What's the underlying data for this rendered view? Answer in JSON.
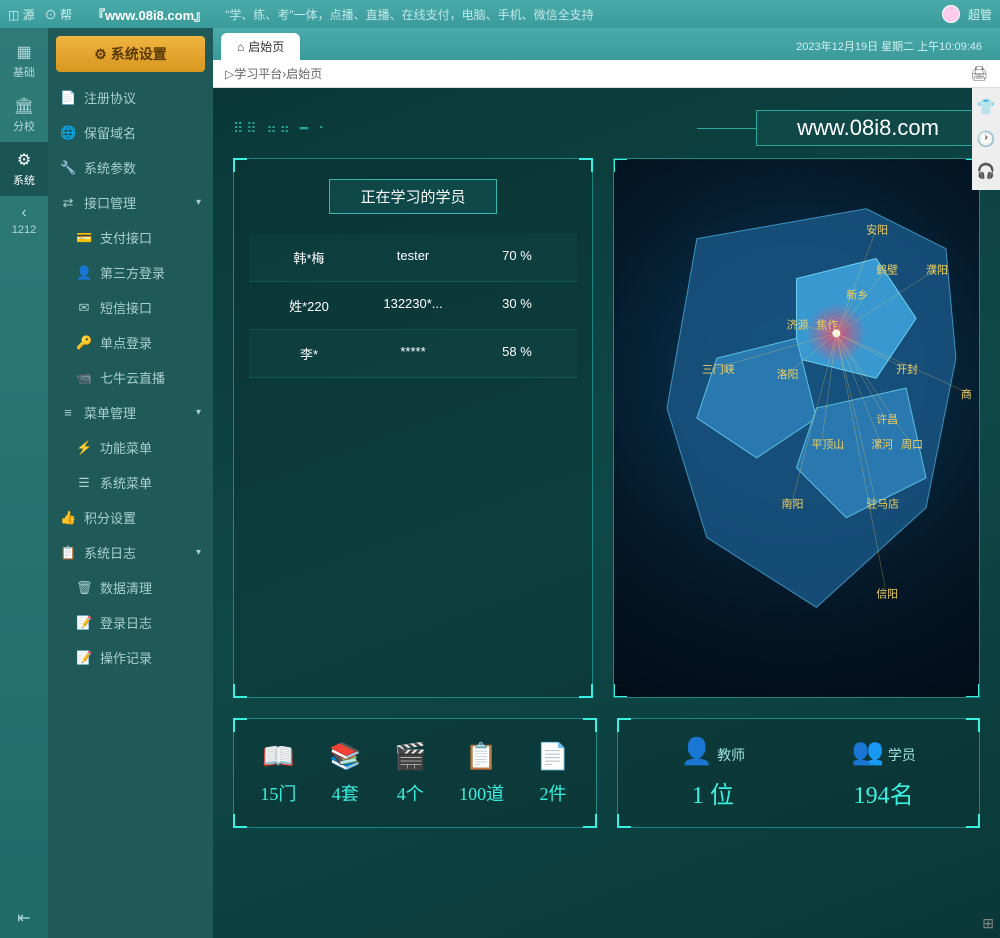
{
  "topbar": {
    "source": "源",
    "help": "帮",
    "site": "『www.08i8.com』",
    "tagline": "\"学、练、考\"一体，点播、直播、在线支付，电脑、手机、微信全支持",
    "user": "超管"
  },
  "leftbar": {
    "items": [
      {
        "label": "基础"
      },
      {
        "label": "分校"
      },
      {
        "label": "系统"
      }
    ],
    "history": "1212"
  },
  "sidebar": {
    "header": "⚙ 系统设置",
    "items": [
      {
        "icon": "📄",
        "label": "注册协议"
      },
      {
        "icon": "🌐",
        "label": "保留域名"
      },
      {
        "icon": "🔧",
        "label": "系统参数"
      },
      {
        "icon": "⇄",
        "label": "接口管理",
        "expand": true
      },
      {
        "icon": "💳",
        "label": "支付接口",
        "sub": true
      },
      {
        "icon": "👤",
        "label": "第三方登录",
        "sub": true
      },
      {
        "icon": "✉",
        "label": "短信接口",
        "sub": true
      },
      {
        "icon": "🔑",
        "label": "单点登录",
        "sub": true
      },
      {
        "icon": "📹",
        "label": "七牛云直播",
        "sub": true
      },
      {
        "icon": "≡",
        "label": "菜单管理",
        "expand": true
      },
      {
        "icon": "⚡",
        "label": "功能菜单",
        "sub": true
      },
      {
        "icon": "☰",
        "label": "系统菜单",
        "sub": true
      },
      {
        "icon": "👍",
        "label": "积分设置"
      },
      {
        "icon": "📋",
        "label": "系统日志",
        "expand": true
      },
      {
        "icon": "🗑",
        "label": "数据清理",
        "sub": true
      },
      {
        "icon": "📝",
        "label": "登录日志",
        "sub": true
      },
      {
        "icon": "📝",
        "label": "操作记录",
        "sub": true
      }
    ]
  },
  "tabs": {
    "active": "启始页",
    "datetime": "2023年12月19日 星期二 上午10:09:46"
  },
  "breadcrumb": {
    "root": "学习平台",
    "page": "启始页"
  },
  "dashboard": {
    "brand": "www.08i8.com",
    "students_title": "正在学习的学员",
    "students": [
      {
        "name": "韩*梅",
        "account": "tester",
        "progress": "70 %"
      },
      {
        "name": "姓*220",
        "account": "132230*...",
        "progress": "30 %"
      },
      {
        "name": "李*",
        "account": "*****",
        "progress": "58 %"
      }
    ],
    "map_cities": [
      "安阳",
      "鹤壁",
      "濮阳",
      "新乡",
      "济源",
      "焦作",
      "三门峡",
      "洛阳",
      "开封",
      "许昌",
      "平顶山",
      "漯河",
      "周口",
      "南阳",
      "驻马店",
      "信阳",
      "商"
    ],
    "stats_left": [
      {
        "icon": "📖",
        "val": "15门"
      },
      {
        "icon": "📚",
        "val": "4套"
      },
      {
        "icon": "🎬",
        "val": "4个"
      },
      {
        "icon": "📋",
        "val": "100道"
      },
      {
        "icon": "📄",
        "val": "2件"
      }
    ],
    "stats_right": [
      {
        "icon": "👤",
        "label": "教师",
        "val": "1 位"
      },
      {
        "icon": "👥",
        "label": "学员",
        "val": "194名"
      }
    ]
  }
}
